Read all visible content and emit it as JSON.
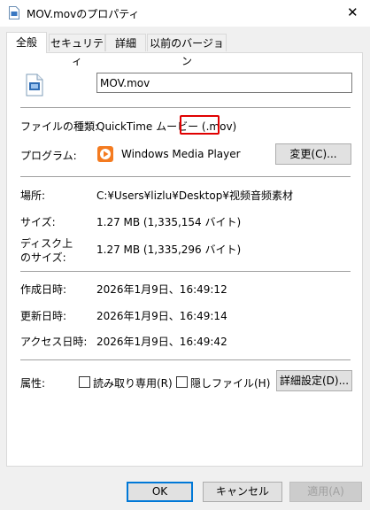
{
  "window": {
    "title": "MOV.movのプロパティ",
    "close_glyph": "✕"
  },
  "tabs": [
    {
      "label": "全般",
      "active": true
    },
    {
      "label": "セキュリティ",
      "active": false
    },
    {
      "label": "詳細",
      "active": false
    },
    {
      "label": "以前のバージョン",
      "active": false
    }
  ],
  "general": {
    "file_name": "MOV.mov",
    "file_type_label": "ファイルの種類:",
    "file_type_value": "QuickTime ムービー (.mov)",
    "program_label": "プログラム:",
    "program_value": "Windows Media Player",
    "change_button": "変更(C)...",
    "location_label": "場所:",
    "location_value": "C:¥Users¥lizlu¥Desktop¥视频音频素材",
    "size_label": "サイズ:",
    "size_value": "1.27 MB (1,335,154 バイト)",
    "size_on_disk_label_line1": "ディスク上",
    "size_on_disk_label_line2": "のサイズ:",
    "size_on_disk_value": "1.27 MB (1,335,296 バイト)",
    "created_label": "作成日時:",
    "created_value": "2026年1月9日、16:49:12",
    "modified_label": "更新日時:",
    "modified_value": "2026年1月9日、16:49:14",
    "accessed_label": "アクセス日時:",
    "accessed_value": "2026年1月9日、16:49:42",
    "attributes_label": "属性:",
    "readonly_label": "読み取り専用(R)",
    "readonly_checked": false,
    "hidden_label": "隠しファイル(H)",
    "hidden_checked": false,
    "advanced_button": "詳細設定(D)..."
  },
  "footer": {
    "ok": "OK",
    "cancel": "キャンセル",
    "apply": "適用(A)"
  },
  "colors": {
    "highlight": "#e00000",
    "ok_border": "#0078d7",
    "media_player_orange": "#f47b20"
  }
}
